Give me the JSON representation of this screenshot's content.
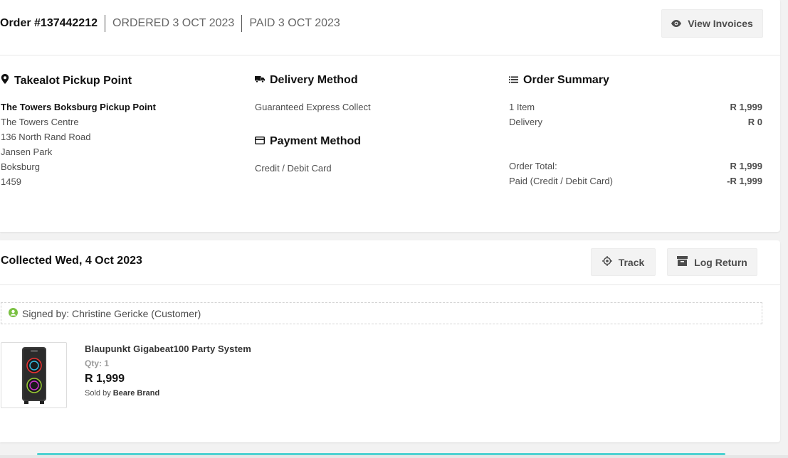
{
  "header": {
    "order_number": "Order #137442212",
    "ordered": "ORDERED 3 OCT 2023",
    "paid": "PAID 3 OCT 2023",
    "view_invoices_label": "View Invoices"
  },
  "pickup": {
    "title": "Takealot Pickup Point",
    "name": "The Towers Boksburg Pickup Point",
    "address": [
      "The Towers Centre",
      "136 North Rand Road",
      "Jansen Park",
      "Boksburg",
      "1459"
    ]
  },
  "delivery": {
    "title": "Delivery Method",
    "value": "Guaranteed Express Collect"
  },
  "payment": {
    "title": "Payment Method",
    "value": "Credit / Debit Card"
  },
  "summary": {
    "title": "Order Summary",
    "rows": [
      {
        "label": "1 Item",
        "value": "R 1,999"
      },
      {
        "label": "Delivery",
        "value": "R 0"
      }
    ],
    "totals": [
      {
        "label": "Order Total:",
        "value": "R 1,999"
      },
      {
        "label": "Paid (Credit / Debit Card)",
        "value": "-R 1,999"
      }
    ]
  },
  "shipment": {
    "title": "Collected Wed, 4 Oct 2023",
    "track_label": "Track",
    "log_return_label": "Log Return",
    "signed_by": "Signed by: Christine Gericke (Customer)"
  },
  "product": {
    "name": "Blaupunkt Gigabeat100 Party System",
    "qty": "Qty: 1",
    "price": "R 1,999",
    "sold_by_prefix": "Sold by",
    "seller": "Beare Brand"
  },
  "colors": {
    "signed_icon": "#7ac142",
    "accent_bar": "#4fd1d1"
  },
  "icons": [
    "eye-icon",
    "map-pin-icon",
    "truck-icon",
    "list-icon",
    "credit-card-icon",
    "crosshair-icon",
    "archive-icon",
    "user-check-icon"
  ]
}
